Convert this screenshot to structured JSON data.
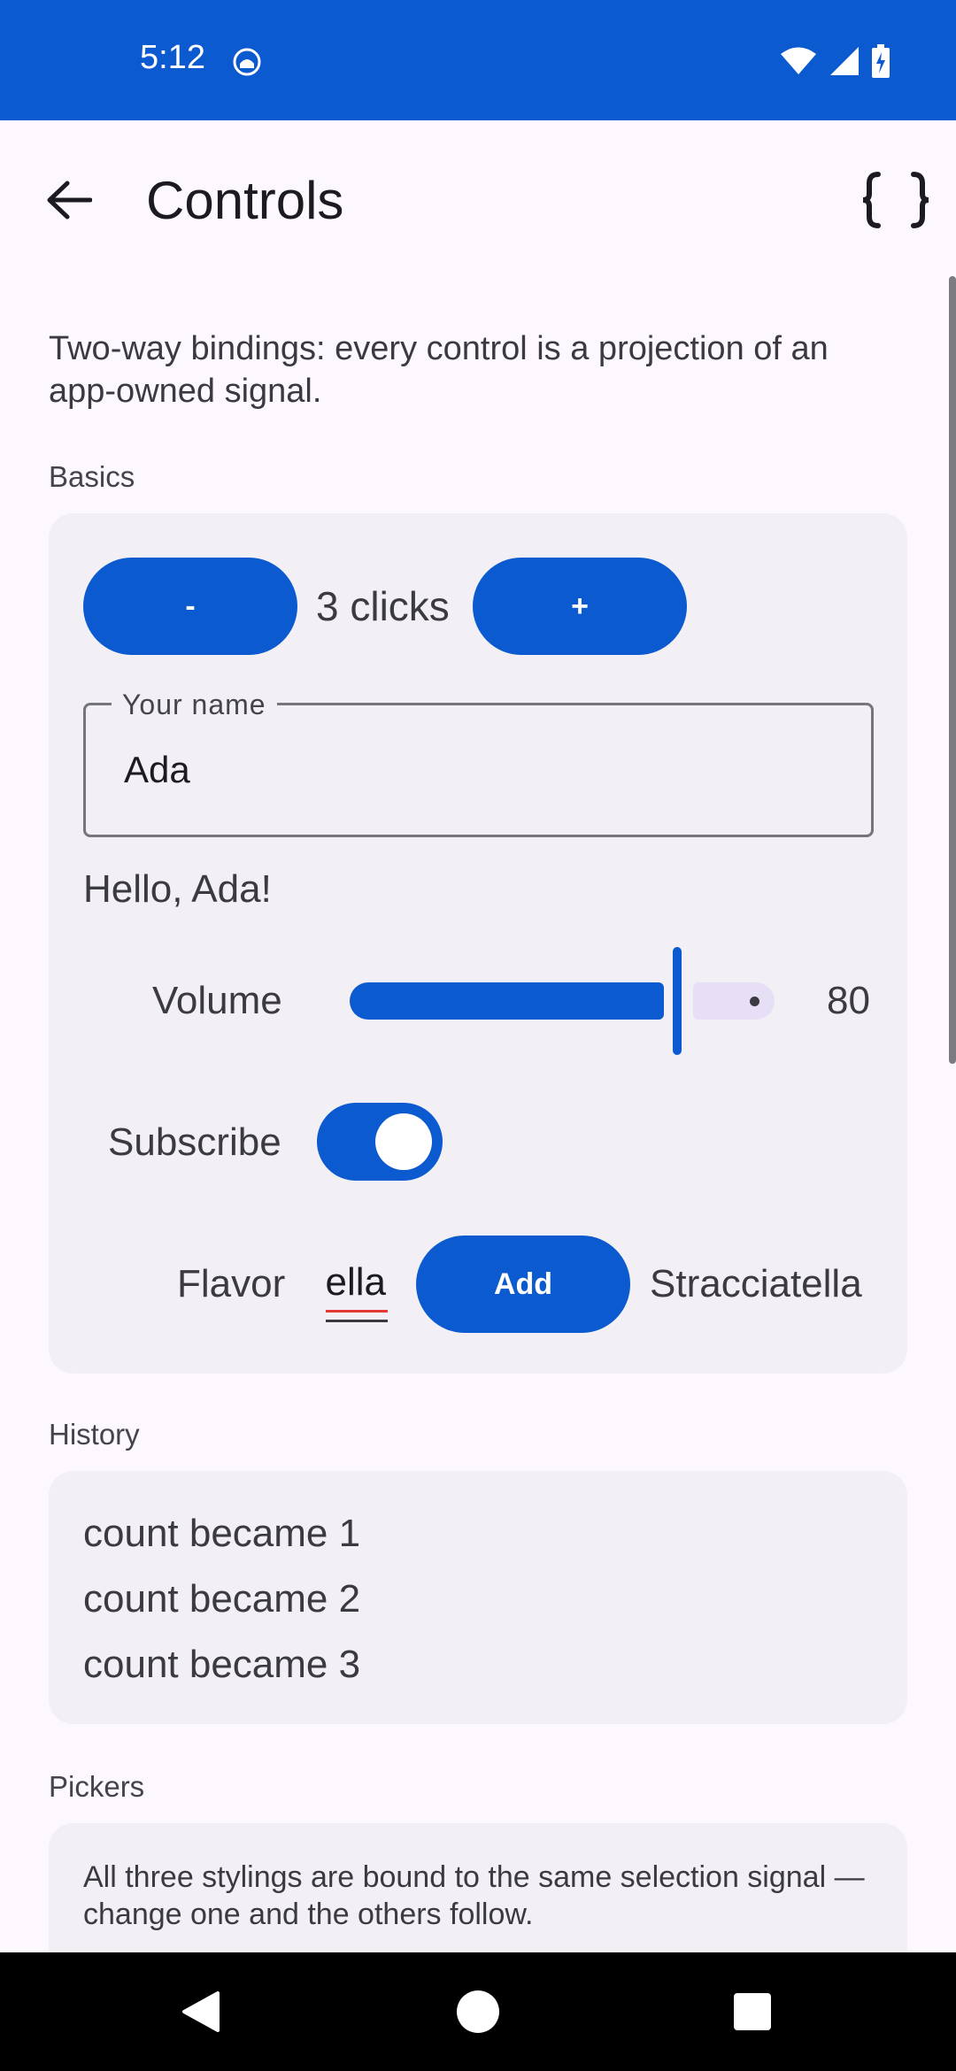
{
  "status_bar": {
    "time": "5:12",
    "background": "#0b5acf"
  },
  "app_bar": {
    "title": "Controls",
    "back_icon": "arrow-back-icon",
    "action_icon": "curly-braces-icon"
  },
  "intro": "Two-way bindings: every control is a projection of an app-owned signal.",
  "basics": {
    "label": "Basics",
    "decrement_label": "-",
    "increment_label": "+",
    "clicks_text": "3 clicks",
    "name_field": {
      "label": "Your name",
      "value": "Ada"
    },
    "greeting": "Hello, Ada!",
    "volume": {
      "label": "Volume",
      "value": "80",
      "level_percent": 80
    },
    "subscribe": {
      "label": "Subscribe",
      "on": true
    },
    "flavor": {
      "label": "Flavor",
      "input_visible_text": "ella",
      "add_label": "Add",
      "result": "Stracciatella"
    }
  },
  "history": {
    "label": "History",
    "entries": [
      "count became 1",
      "count became 2",
      "count became 3"
    ]
  },
  "pickers": {
    "label": "Pickers",
    "description": "All three stylings are bound to the same selection signal — change one and the others follow."
  },
  "colors": {
    "accent": "#0b5acf",
    "surface": "#f2eff5",
    "background": "#fdf8fd"
  }
}
